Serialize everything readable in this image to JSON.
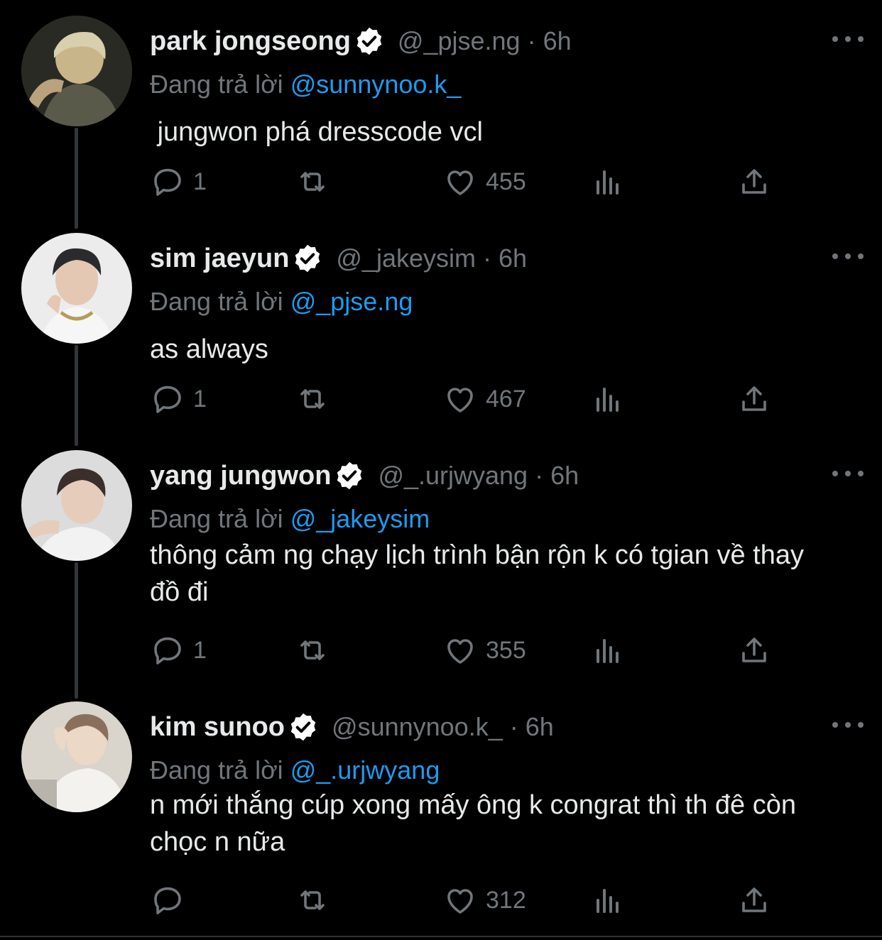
{
  "colors": {
    "background": "#000000",
    "text_primary": "#e7e9ea",
    "text_secondary": "#71767b",
    "link": "#1d9bf0",
    "verified_badge": "#ffffff",
    "thread_line": "#333639"
  },
  "icons": {
    "reply": "reply-icon",
    "retweet": "retweet-icon",
    "like": "heart-icon",
    "views": "views-icon",
    "share": "share-icon",
    "more": "more-icon",
    "verified": "verified-icon"
  },
  "tweets": [
    {
      "name": "park jongseong",
      "handle": "@_pjse.ng",
      "dot": "·",
      "time": "6h",
      "reply_prefix": "Đang trả lời",
      "reply_to": "@sunnynoo.k_",
      "text": " jungwon phá dresscode vcl",
      "replies": "1",
      "retweets": "",
      "likes": "455",
      "views": ""
    },
    {
      "name": "sim jaeyun",
      "handle": "@_jakeysim",
      "dot": "·",
      "time": "6h",
      "reply_prefix": "Đang trả lời",
      "reply_to": "@_pjse.ng",
      "text": "as always",
      "replies": "1",
      "retweets": "",
      "likes": "467",
      "views": ""
    },
    {
      "name": "yang jungwon",
      "handle": "@_.urjwyang",
      "dot": "·",
      "time": "6h",
      "reply_prefix": "Đang trả lời",
      "reply_to": "@_jakeysim",
      "text": "thông cảm ng chạy lịch trình bận rộn k có tgian về thay đồ đi",
      "replies": "1",
      "retweets": "",
      "likes": "355",
      "views": ""
    },
    {
      "name": "kim sunoo",
      "handle": "@sunnynoo.k_",
      "dot": "·",
      "time": "6h",
      "reply_prefix": "Đang trả lời",
      "reply_to": "@_.urjwyang",
      "text": "n mới thắng cúp xong mấy ông k congrat thì th đê còn chọc n nữa",
      "replies": "",
      "retweets": "",
      "likes": "312",
      "views": ""
    }
  ]
}
